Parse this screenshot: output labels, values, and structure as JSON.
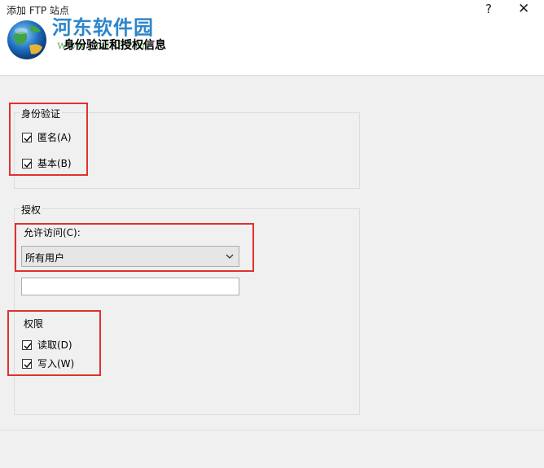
{
  "window": {
    "title": "添加 FTP 站点",
    "help_glyph": "?",
    "close_glyph": "✕"
  },
  "header": {
    "watermark": "河东软件园",
    "watermark_url": "www.pc0359.cn",
    "subtitle": "身份验证和授权信息"
  },
  "authentication": {
    "label": "身份验证",
    "options": [
      {
        "label": "匿名(A)",
        "checked": true
      },
      {
        "label": "基本(B)",
        "checked": true
      }
    ]
  },
  "authorization": {
    "label": "授权",
    "allow_access_label": "允许访问(C):",
    "allow_access_value": "所有用户",
    "allow_access_input_value": "",
    "permissions": {
      "label": "权限",
      "options": [
        {
          "label": "读取(D)",
          "checked": true
        },
        {
          "label": "写入(W)",
          "checked": true
        }
      ]
    }
  },
  "colors": {
    "highlight": "#e0312f",
    "watermark": "#2e86c9"
  }
}
